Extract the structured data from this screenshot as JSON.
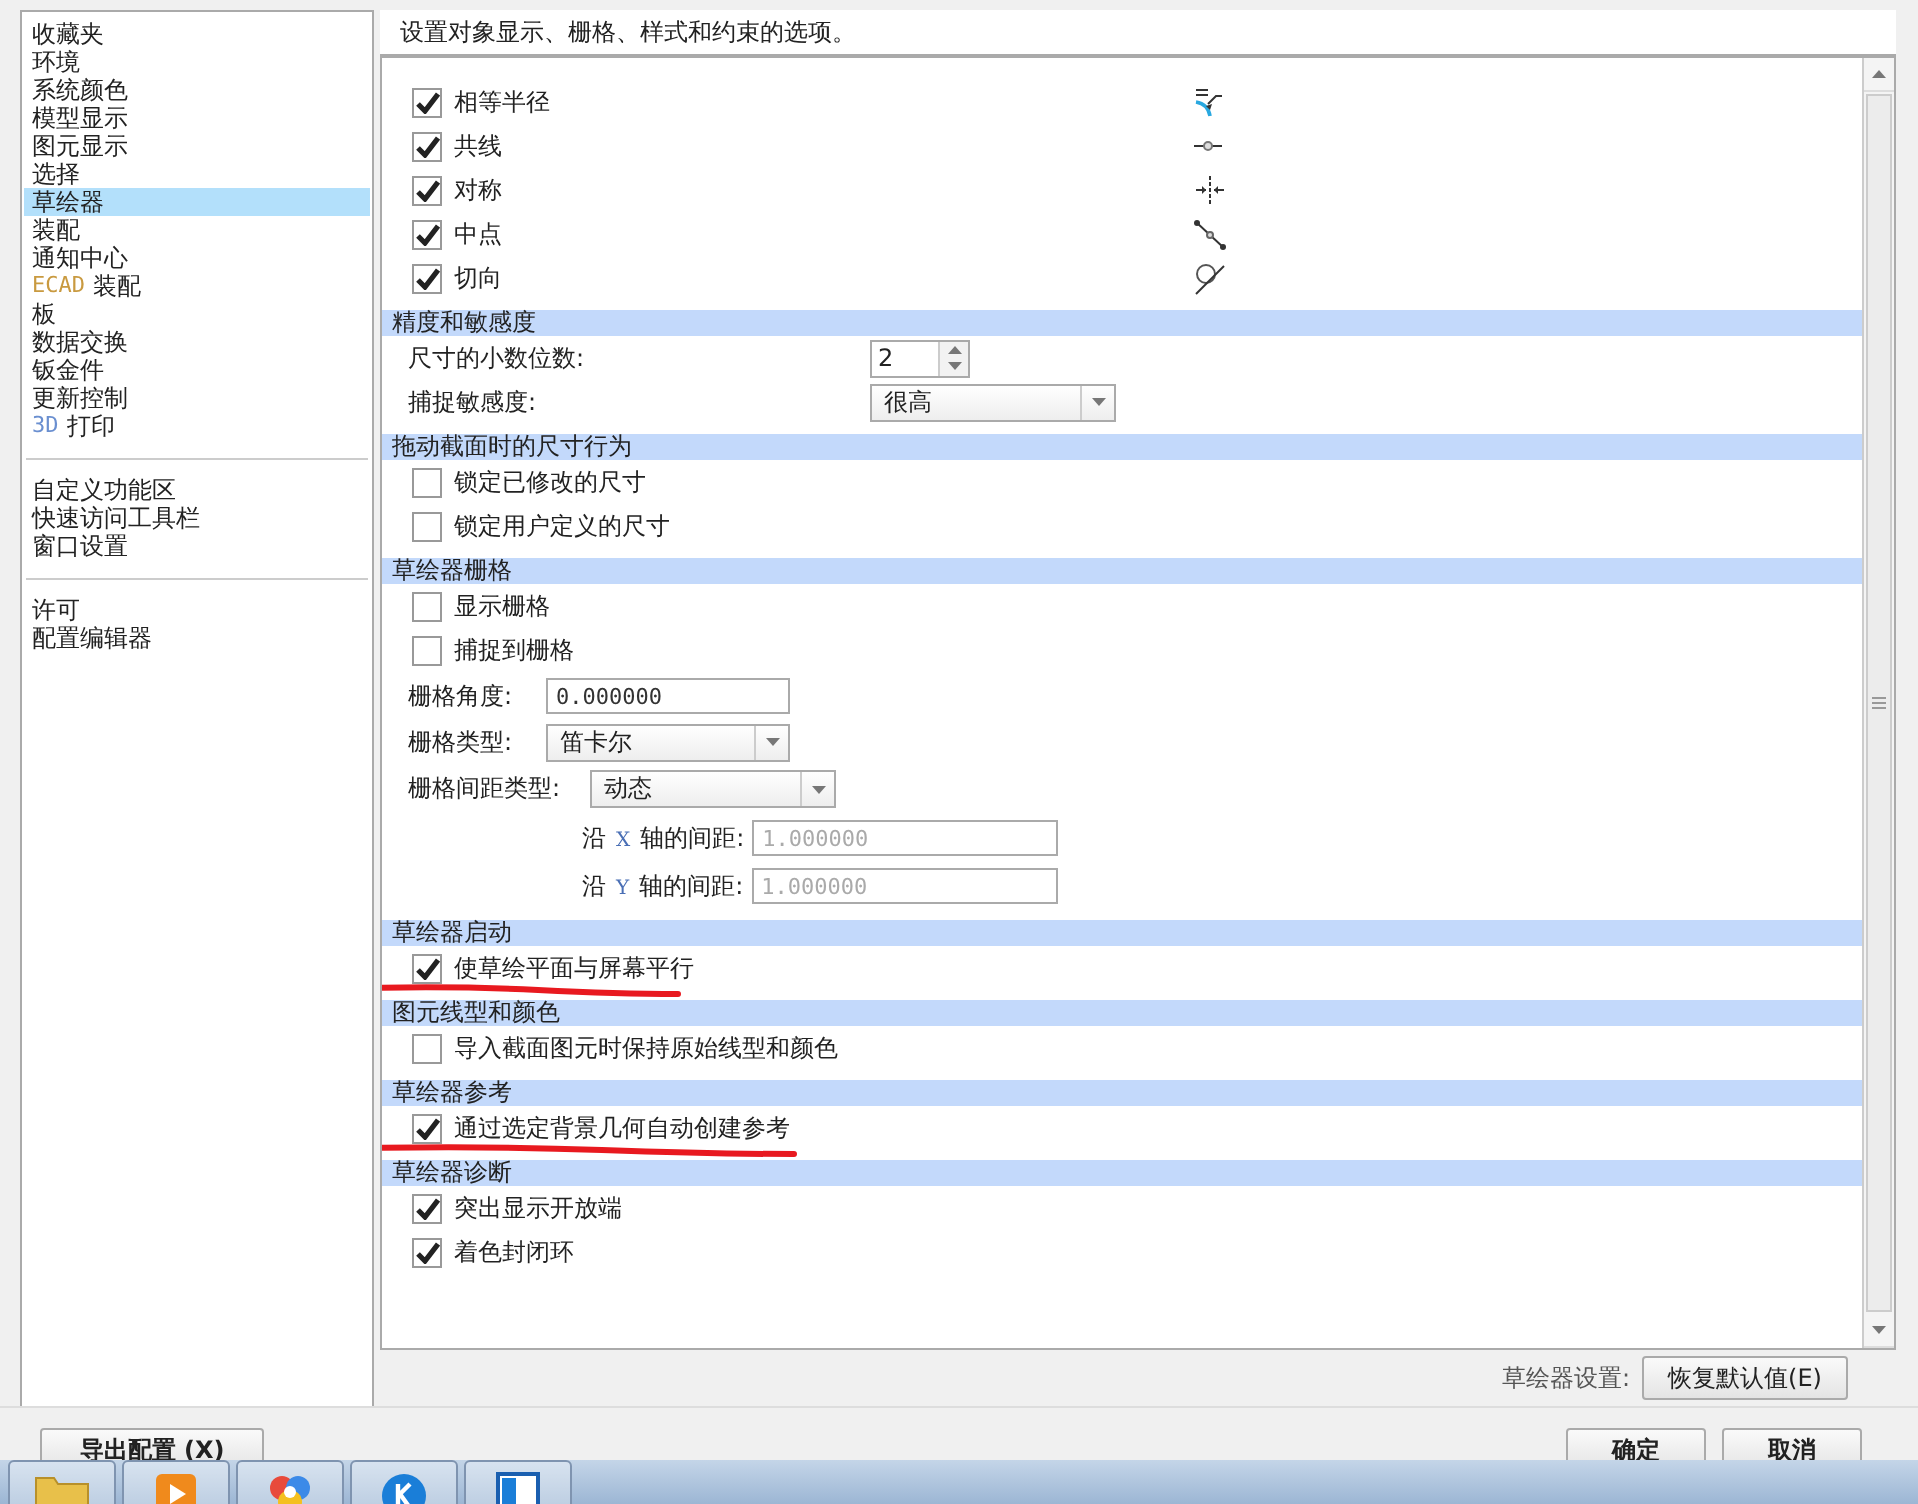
{
  "sidebar": {
    "groups": [
      {
        "items": [
          {
            "label": "收藏夹",
            "selected": false
          },
          {
            "label": "环境",
            "selected": false
          },
          {
            "label": "系统颜色",
            "selected": false
          },
          {
            "label": "模型显示",
            "selected": false
          },
          {
            "label": "图元显示",
            "selected": false
          },
          {
            "label": "选择",
            "selected": false
          },
          {
            "label": "草绘器",
            "selected": true
          },
          {
            "label": "装配",
            "selected": false
          },
          {
            "label": "通知中心",
            "selected": false
          },
          {
            "prefix": "ECAD",
            "label": "装配",
            "selected": false
          },
          {
            "label": "板",
            "selected": false
          },
          {
            "label": "数据交换",
            "selected": false
          },
          {
            "label": "钣金件",
            "selected": false
          },
          {
            "label": "更新控制",
            "selected": false
          },
          {
            "prefix": "3D",
            "label": "打印",
            "selected": false
          }
        ]
      },
      {
        "items": [
          {
            "label": "自定义功能区",
            "selected": false
          },
          {
            "label": "快速访问工具栏",
            "selected": false
          },
          {
            "label": "窗口设置",
            "selected": false
          }
        ]
      },
      {
        "items": [
          {
            "label": "许可",
            "selected": false
          },
          {
            "label": "配置编辑器",
            "selected": false
          }
        ]
      }
    ]
  },
  "description": "设置对象显示、栅格、样式和约束的选项。",
  "sections": [
    {
      "rows": [
        {
          "kind": "checkbox",
          "label": "相等半径",
          "checked": true
        },
        {
          "kind": "checkbox",
          "label": "共线",
          "checked": true
        },
        {
          "kind": "checkbox",
          "label": "对称",
          "checked": true
        },
        {
          "kind": "checkbox",
          "label": "中点",
          "checked": true
        },
        {
          "kind": "checkbox",
          "label": "切向",
          "checked": true
        }
      ]
    },
    {
      "title": "精度和敏感度",
      "rows": [
        {
          "kind": "spinner",
          "label": "尺寸的小数位数:",
          "value": "2"
        },
        {
          "kind": "dropdown",
          "label": "捕捉敏感度:",
          "value": "很高"
        }
      ]
    },
    {
      "title": "拖动截面时的尺寸行为",
      "rows": [
        {
          "kind": "checkbox",
          "label": "锁定已修改的尺寸",
          "checked": false
        },
        {
          "kind": "checkbox",
          "label": "锁定用户定义的尺寸",
          "checked": false
        }
      ]
    },
    {
      "title": "草绘器栅格",
      "rows": [
        {
          "kind": "checkbox",
          "label": "显示栅格",
          "checked": false
        },
        {
          "kind": "checkbox",
          "label": "捕捉到栅格",
          "checked": false
        },
        {
          "kind": "input",
          "label": "栅格角度:",
          "value": "0.000000",
          "disabled": false
        },
        {
          "kind": "dropdown_short",
          "label": "栅格类型:",
          "value": "笛卡尔"
        },
        {
          "kind": "dropdown_wide",
          "label": "栅格间距类型:",
          "value": "动态"
        },
        {
          "kind": "axis_input",
          "label": "沿",
          "axis": "X",
          "label_end": "轴的间距:",
          "value": "1.000000",
          "disabled": true
        },
        {
          "kind": "axis_input",
          "label": "沿",
          "axis": "Y",
          "label_end": "轴的间距:",
          "value": "1.000000",
          "disabled": true
        }
      ]
    },
    {
      "title": "草绘器启动",
      "rows": [
        {
          "kind": "checkbox",
          "label": "使草绘平面与屏幕平行",
          "checked": true,
          "underlined": true
        }
      ]
    },
    {
      "title": "图元线型和颜色",
      "rows": [
        {
          "kind": "checkbox",
          "label": "导入截面图元时保持原始线型和颜色",
          "checked": false
        }
      ]
    },
    {
      "title": "草绘器参考",
      "rows": [
        {
          "kind": "checkbox",
          "label": "通过选定背景几何自动创建参考",
          "checked": true,
          "underlined": true
        }
      ]
    },
    {
      "title": "草绘器诊断",
      "rows": [
        {
          "kind": "checkbox",
          "label": "突出显示开放端",
          "checked": true
        },
        {
          "kind": "checkbox",
          "label": "着色封闭环",
          "checked": true
        }
      ]
    }
  ],
  "footer": {
    "label": "草绘器设置:",
    "button": "恢复默认值(E)"
  },
  "dialog_buttons": [
    {
      "label": "导出配置 (X)"
    },
    {
      "label": "确定"
    },
    {
      "label": "取消"
    }
  ],
  "taskbar": {
    "icons": [
      {
        "kind": "folder"
      },
      {
        "kind": "media"
      },
      {
        "kind": "petals"
      },
      {
        "kind": "k"
      },
      {
        "kind": "window"
      }
    ]
  }
}
